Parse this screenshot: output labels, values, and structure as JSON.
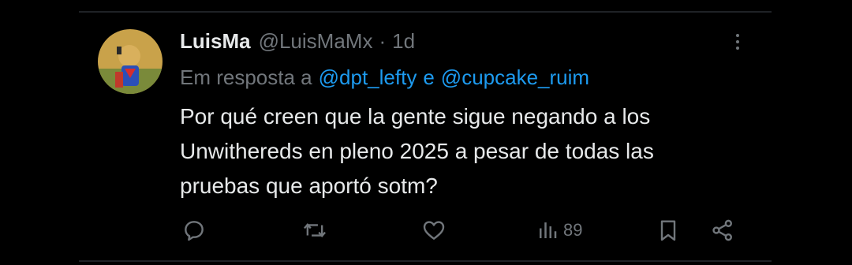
{
  "post": {
    "display_name": "LuisMa",
    "handle": "@LuisMaMx",
    "separator": "·",
    "time": "1d",
    "reply_prefix": "Em resposta a",
    "mentions": [
      "@dpt_lefty",
      "@cupcake_ruim"
    ],
    "mention_conjunction": "e",
    "text_lines": [
      "Por qué creen que la gente sigue negando a los",
      "Unwithereds en pleno 2025 a pesar de todas las",
      "pruebas que aportó sotm?"
    ]
  },
  "actions": {
    "reply_icon": "reply-icon",
    "repost_icon": "repost-icon",
    "like_icon": "heart-icon",
    "views_icon": "views-icon",
    "views_count": "89",
    "bookmark_icon": "bookmark-icon",
    "share_icon": "share-icon"
  },
  "colors": {
    "background": "#000000",
    "text_primary": "#e7e9ea",
    "text_secondary": "#71767b",
    "link": "#1d9bf0"
  }
}
